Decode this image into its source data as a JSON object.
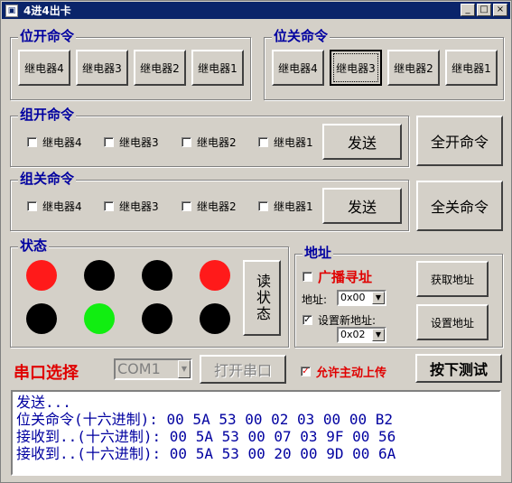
{
  "window": {
    "title": "4进4出卡",
    "minimize": "_",
    "maximize": "□",
    "close": "×"
  },
  "bit_on": {
    "title": "位开命令",
    "buttons": [
      "继电器4",
      "继电器3",
      "继电器2",
      "继电器1"
    ]
  },
  "bit_off": {
    "title": "位关命令",
    "buttons": [
      "继电器4",
      "继电器3",
      "继电器2",
      "继电器1"
    ],
    "pressed_index": 1
  },
  "group_on": {
    "title": "组开命令",
    "checkboxes": [
      "继电器4",
      "继电器3",
      "继电器2",
      "继电器1"
    ],
    "send": "发送",
    "all": "全开命令"
  },
  "group_off": {
    "title": "组关命令",
    "checkboxes": [
      "继电器4",
      "继电器3",
      "继电器2",
      "继电器1"
    ],
    "send": "发送",
    "all": "全关命令"
  },
  "status": {
    "title": "状态",
    "read_button": "读状态",
    "leds": [
      "red",
      "black",
      "black",
      "red",
      "black",
      "green",
      "black",
      "black"
    ],
    "colors": {
      "red": "#ff1a1a",
      "green": "#11ee11",
      "black": "#000000"
    }
  },
  "address": {
    "title": "地址",
    "broadcast": "广播寻址",
    "addr_label": "地址:",
    "addr_value": "0x00",
    "set_new_label": "设置新地址:",
    "set_new_checked": true,
    "new_value": "0x02",
    "get_button": "获取地址",
    "set_button": "设置地址"
  },
  "serial": {
    "label": "串口选择",
    "port": "COM1",
    "open_button": "打开串口",
    "auto_upload": "允许主动上传",
    "auto_upload_checked": true,
    "test_button": "按下测试"
  },
  "log": [
    "发送...",
    "位关命令(十六进制): 00 5A 53 00 02 03 00 00 B2",
    "接收到..(十六进制): 00 5A 53 00 07 03 9F 00 56",
    "接收到..(十六进制): 00 5A 53 00 20 00 9D 00 6A"
  ]
}
